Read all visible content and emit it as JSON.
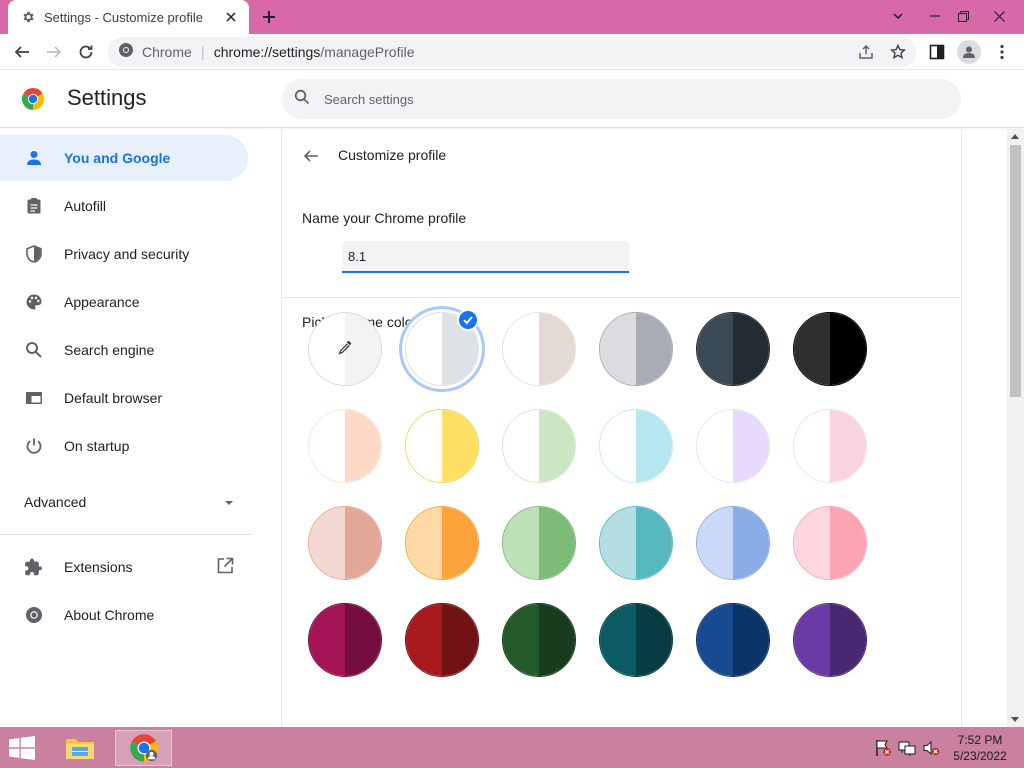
{
  "browser": {
    "tab_title": "Settings - Customize profile",
    "omnibox_site": "Chrome",
    "omnibox_url_host": "chrome://settings",
    "omnibox_url_path": "/manageProfile"
  },
  "header": {
    "title": "Settings",
    "search_placeholder": "Search settings"
  },
  "sidebar": {
    "items": [
      {
        "label": "You and Google",
        "icon": "person-icon"
      },
      {
        "label": "Autofill",
        "icon": "clipboard-icon"
      },
      {
        "label": "Privacy and security",
        "icon": "shield-icon"
      },
      {
        "label": "Appearance",
        "icon": "palette-icon"
      },
      {
        "label": "Search engine",
        "icon": "search-icon"
      },
      {
        "label": "Default browser",
        "icon": "browser-window-icon"
      },
      {
        "label": "On startup",
        "icon": "power-icon"
      }
    ],
    "advanced_label": "Advanced",
    "extensions_label": "Extensions",
    "about_label": "About Chrome"
  },
  "main": {
    "page_title": "Customize profile",
    "name_label": "Name your Chrome profile",
    "name_value": "8.1",
    "theme_label": "Pick a theme color",
    "selected_theme_index": 1,
    "themes": [
      {
        "type": "picker"
      },
      {
        "left": "#ffffff",
        "right": "#dee1e6",
        "border": "#dee1e6"
      },
      {
        "left": "#ffffff",
        "right": "#e5d9d5",
        "border": "#e8e0dd"
      },
      {
        "left": "#dadce0",
        "right": "#a9acb5",
        "border": "#a9acb5"
      },
      {
        "left": "#3b4a57",
        "right": "#242c33",
        "border": "#242c33"
      },
      {
        "left": "#2f2f2f",
        "right": "#000000",
        "border": "#000000"
      },
      {
        "left": "#ffffff",
        "right": "#fddac8",
        "border": "#fde4d8"
      },
      {
        "left": "#ffffff",
        "right": "#fde064",
        "border": "#f5d75a"
      },
      {
        "left": "#ffffff",
        "right": "#cae6c3",
        "border": "#d4ebce"
      },
      {
        "left": "#ffffff",
        "right": "#b6e6f0",
        "border": "#c7ecf3"
      },
      {
        "left": "#ffffff",
        "right": "#e7dafc",
        "border": "#ece2fc"
      },
      {
        "left": "#ffffff",
        "right": "#f7d4e0",
        "border": "#f8dde6"
      },
      {
        "left": "#f3d8d1",
        "right": "#e2a796",
        "border": "#e2a796"
      },
      {
        "left": "#fed9a6",
        "right": "#fca43c",
        "border": "#fca43c"
      },
      {
        "left": "#bde0b6",
        "right": "#7dbb78",
        "border": "#7dbb78"
      },
      {
        "left": "#b4dde2",
        "right": "#58b8c2",
        "border": "#58b8c2"
      },
      {
        "left": "#cbd9f8",
        "right": "#8aace8",
        "border": "#8aace8"
      },
      {
        "left": "#fdd6de",
        "right": "#fba5b4",
        "border": "#fba5b4"
      },
      {
        "left": "#a31355",
        "right": "#740c3e",
        "border": "#740c3e"
      },
      {
        "left": "#a61a1d",
        "right": "#711314",
        "border": "#711314"
      },
      {
        "left": "#245a2a",
        "right": "#193b1e",
        "border": "#193b1e"
      },
      {
        "left": "#0a5b64",
        "right": "#063c42",
        "border": "#063c42"
      },
      {
        "left": "#164a91",
        "right": "#0d3466",
        "border": "#0d3466"
      },
      {
        "left": "#6c3aa5",
        "right": "#4a2772",
        "border": "#4a2772"
      }
    ]
  },
  "taskbar": {
    "time": "7:52 PM",
    "date": "5/23/2022"
  }
}
